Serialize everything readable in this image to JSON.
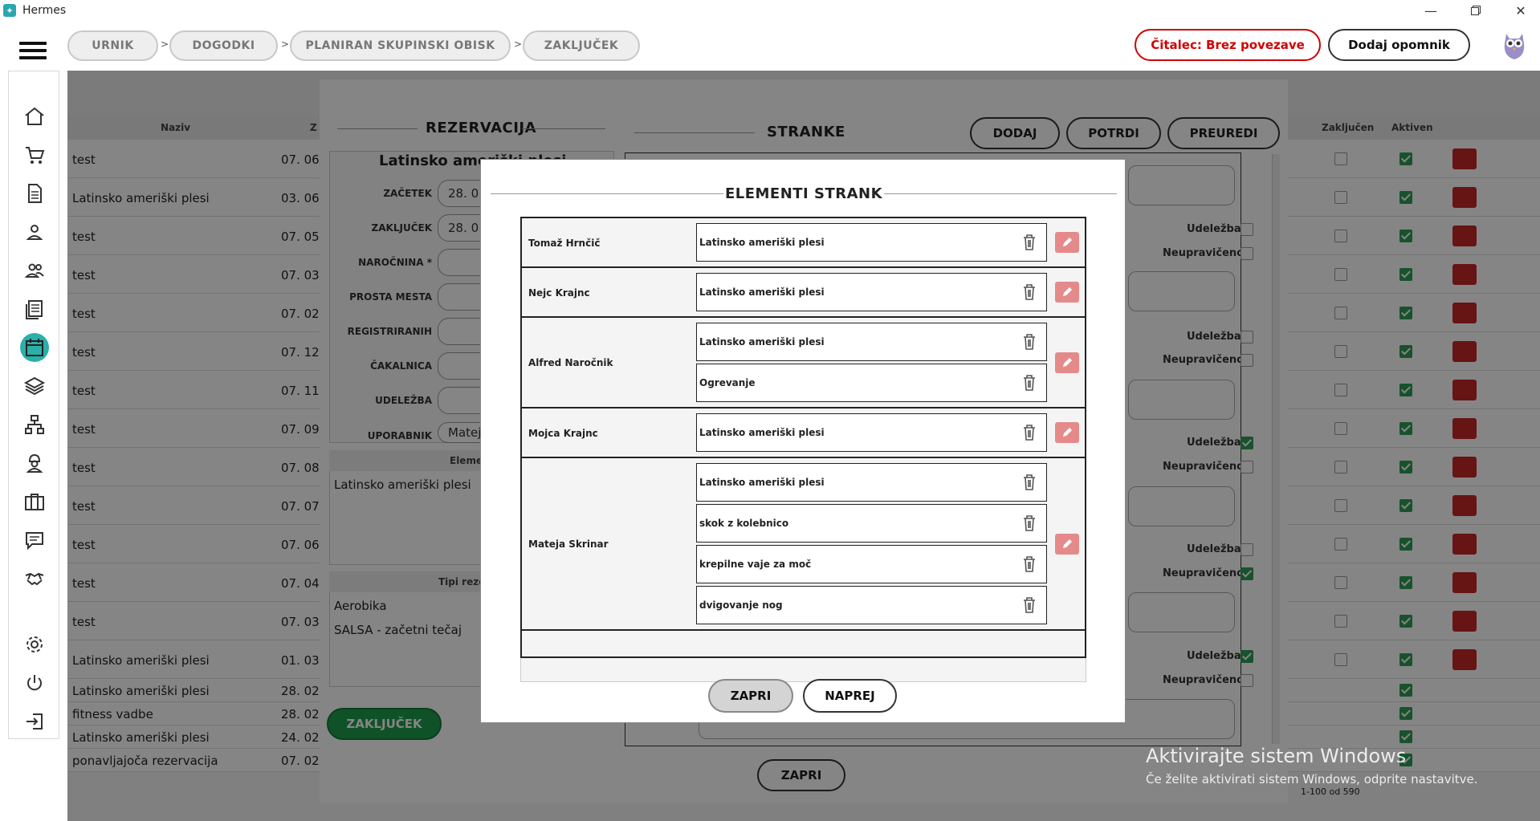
{
  "window": {
    "title": "Hermes",
    "logo": "hermes-logo"
  },
  "breadcrumbs": [
    "URNIK",
    "DOGODKI",
    "PLANIRAN SKUPINSKI OBISK",
    "ZAKLJUČEK"
  ],
  "crumb_separator": ">",
  "header_buttons": {
    "reader_status": "Čitalec: Brez povezave",
    "add_reminder": "Dodaj opomnik"
  },
  "colors": {
    "accent": "#2ab0a8",
    "danger": "#d00000",
    "success": "#1e9e4b",
    "edit": "#e58a8a"
  },
  "sidebar_icons": [
    "home-icon",
    "cart-icon",
    "document-icon",
    "user-icon",
    "users-icon",
    "notes-icon",
    "calendar-icon",
    "layers-icon",
    "hierarchy-icon",
    "worker-icon",
    "briefcase-icon",
    "chat-icon",
    "handshake-icon",
    "gear-icon",
    "power-icon",
    "logout-icon"
  ],
  "background_list": {
    "col_name": "Naziv",
    "col_date": "Z",
    "col_closed": "Zaključen",
    "col_active": "Aktiven",
    "rows": [
      {
        "name": "test",
        "date": "07. 06."
      },
      {
        "name": "Latinsko ameriški plesi",
        "date": "03. 06."
      },
      {
        "name": "test",
        "date": "07. 05."
      },
      {
        "name": "test",
        "date": "07. 03."
      },
      {
        "name": "test",
        "date": "07. 02."
      },
      {
        "name": "test",
        "date": "07. 12."
      },
      {
        "name": "test",
        "date": "07. 11."
      },
      {
        "name": "test",
        "date": "07. 09."
      },
      {
        "name": "test",
        "date": "07. 08."
      },
      {
        "name": "test",
        "date": "07. 07."
      },
      {
        "name": "test",
        "date": "07. 06."
      },
      {
        "name": "test",
        "date": "07. 04."
      },
      {
        "name": "test",
        "date": "07. 03."
      },
      {
        "name": "Latinsko ameriški plesi",
        "date": "01. 03."
      },
      {
        "name": "Latinsko ameriški plesi",
        "date": "28. 02."
      },
      {
        "name": "fitness vadbe",
        "date": "28. 02."
      },
      {
        "name": "Latinsko ameriški plesi",
        "date": "24. 02."
      },
      {
        "name": "ponavljajoča rezervacija",
        "date": "07. 02."
      }
    ],
    "pager": "1-100 od 590"
  },
  "reservation": {
    "title": "REZERVACIJA",
    "event_name": "Latinsko ameriški plesi",
    "fields": [
      {
        "label": "ZAČETEK",
        "value": "28. 0"
      },
      {
        "label": "ZAKLJUČEK",
        "value": "28. 0"
      },
      {
        "label": "NAROČNINA *",
        "value": ""
      },
      {
        "label": "PROSTA MESTA",
        "value": ""
      },
      {
        "label": "REGISTRIRANIH",
        "value": ""
      },
      {
        "label": "ČAKALNICA",
        "value": ""
      },
      {
        "label": "UDELEŽBA",
        "value": ""
      },
      {
        "label": "UPORABNIK",
        "value": "Matej"
      }
    ],
    "elements_header": "Elemen",
    "elements": [
      "Latinsko ameriški plesi"
    ],
    "types_header": "Tipi rezer",
    "types": [
      "Aerobika",
      "SALSA - začetni tečaj"
    ],
    "finish_button": "ZAKLJUČEK",
    "close_button": "ZAPRI"
  },
  "customers": {
    "title": "STRANKE",
    "buttons": [
      "DODAJ",
      "POTRDI",
      "PREUREDI"
    ],
    "attendance_label": "Udeležba",
    "unexcused_label": "Neupravičeno"
  },
  "modal": {
    "title": "ELEMENTI STRANK",
    "rows": [
      {
        "name": "Tomaž Hrnčič",
        "elements": [
          "Latinsko ameriški plesi"
        ]
      },
      {
        "name": "Nejc Krajnc",
        "elements": [
          "Latinsko ameriški plesi"
        ]
      },
      {
        "name": "Alfred Naročnik",
        "elements": [
          "Latinsko ameriški plesi",
          "Ogrevanje"
        ]
      },
      {
        "name": "Mojca Krajnc",
        "elements": [
          "Latinsko ameriški plesi"
        ]
      },
      {
        "name": "Mateja Skrinar",
        "elements": [
          "Latinsko ameriški plesi",
          "skok z kolebnico",
          "krepilne vaje za moč",
          "dvigovanje nog"
        ]
      }
    ],
    "close_button": "ZAPRI",
    "next_button": "NAPREJ"
  },
  "watermark": {
    "line1": "Aktivirajte sistem Windows",
    "line2": "Če želite aktivirati sistem Windows, odprite nastavitve."
  }
}
